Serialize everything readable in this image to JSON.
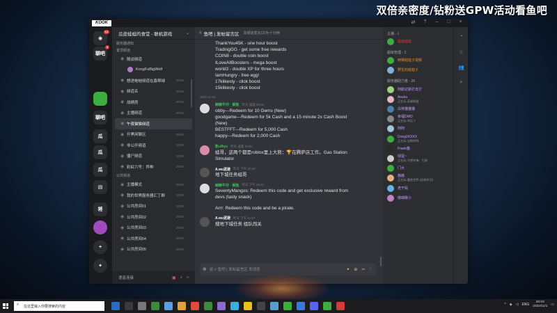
{
  "overlay": {
    "banner": "双倍亲密度/钻粉送GPW活动看鱼吧"
  },
  "window": {
    "logo": "KOOK",
    "controls": [
      "⇄",
      "?",
      "–",
      "□",
      "×"
    ]
  },
  "rail": {
    "servers": [
      {
        "label": "◉",
        "badge": "12",
        "color": "#2b2d31"
      },
      {
        "label": "聊吧",
        "badge": "4",
        "color": "#2b2d31"
      },
      {
        "label": "",
        "badge": "",
        "color": "#3cae3f"
      },
      {
        "label": "聊吧",
        "badge": "",
        "color": "#2b2d31"
      },
      {
        "label": "瓜",
        "badge": "",
        "color": "#2b2d31"
      },
      {
        "label": "瓜",
        "badge": "",
        "color": "#2b2d31"
      },
      {
        "label": "瓜",
        "badge": "",
        "color": "#2b2d31"
      },
      {
        "label": "▤",
        "badge": "",
        "color": "#2b2d31"
      },
      {
        "label": "将",
        "badge": "",
        "color": "#2b2d31"
      },
      {
        "label": "",
        "badge": "",
        "color": "#a04bc0"
      },
      {
        "label": "+",
        "badge": "",
        "color": "#2b2d31"
      },
      {
        "label": "✦",
        "badge": "",
        "color": "#2b2d31"
      }
    ]
  },
  "channels": {
    "server_name": "瓜皮蛙蛙的食堂 - 联机游戏",
    "categories": [
      {
        "name": "服务器通知",
        "items": []
      },
      {
        "name": "置顶频道",
        "items": [
          {
            "name": "随谈频道",
            "count": ""
          },
          {
            "name": "KongFuBigWolf",
            "count": "",
            "user": true
          },
          {
            "name": "想进蛙蛙频道在鑫帮绿",
            "count": "20/50"
          },
          {
            "name": "频道名",
            "count": "20/50"
          },
          {
            "name": "战绩房",
            "count": "20/50"
          },
          {
            "name": "主播频道",
            "count": "20/50"
          },
          {
            "name": "午夜猫猫频道",
            "count": "",
            "active": true
          },
          {
            "name": "开黑闲聊区",
            "count": "20/50"
          },
          {
            "name": "非公开频道",
            "count": "20/50"
          },
          {
            "name": "僵尸频道",
            "count": "20/50"
          },
          {
            "name": "彩虹六号：异种",
            "count": "20/50"
          }
        ]
      },
      {
        "name": "公共频道",
        "items": [
          {
            "name": "主播模式",
            "count": "20/50"
          },
          {
            "name": "我的世界服务器汇丁群",
            "count": "20/50"
          },
          {
            "name": "公共房间01",
            "count": "20/50"
          },
          {
            "name": "公共房间02",
            "count": "20/50"
          },
          {
            "name": "公共房间03",
            "count": "20/50"
          },
          {
            "name": "公共房间04",
            "count": "20/50"
          },
          {
            "name": "公共房间05",
            "count": "20/50"
          }
        ]
      }
    ],
    "footer": "语音连接"
  },
  "chat": {
    "channel": "鱼吧 | 发帖留言区",
    "topic": "本频道发言CD为十分钟",
    "pre_lines": [
      "ThankYou45K - one hour boost",
      "TradingGG - get some free rewards",
      "COIN8 - double coin boost",
      "ILoveAllBoosters - mega boost",
      "world3 - double XP for three hours",
      "IamHungry - free egg!",
      "17klikesty - click boost",
      "15klikesty - click boost"
    ],
    "time_sep": "2022-11-01",
    "messages": [
      {
        "author": "鲸鲸牛仔 · 钢鱼",
        "author_color": "#3fbf5a",
        "time": "昨天 凌晨 00:04",
        "avatar": "#dcdcdc",
        "lines": [
          "obby---Redeem for 10 Gems (New)",
          "goodgame---Redeem for 5k Cash and a 15 minute 2x Cash Boost",
          "(New)",
          "BESTFFT---Redeem for 5,000 Cash",
          "happy---Redeem for 2,000 Cash"
        ]
      },
      {
        "author": "影ufkys",
        "author_color": "#3fbf5a",
        "time": "昨天 凌晨 00:04",
        "avatar": "#d98ca8",
        "lines": [
          "蛙哥，这两个都是roblox里上大熊：🏆在腾萨店工作。Gas Station",
          "Simulator"
        ]
      },
      {
        "author": "A.wu泥逊",
        "author_color": "#ffffff",
        "time": "昨天 下午 10:40",
        "avatar": "#555555",
        "lines": [
          "地下城任务蛙哥"
        ]
      },
      {
        "author": "鲸鲸牛仔 · 钢鱼",
        "author_color": "#3fbf5a",
        "time": "昨天 下午 10:41",
        "avatar": "#dcdcdc",
        "lines": [
          "SeventyMangos: Redeem this code and get exclusive reward from",
          "devs (tasty snack)",
          "",
          "Arrr: Redeem this code and be a pirate."
        ]
      },
      {
        "author": "A.wu泥逊",
        "author_color": "#ffffff",
        "time": "昨天 下午 11:57",
        "avatar": "#555555",
        "lines": [
          "搜地下城任务 组队闯关"
        ]
      }
    ],
    "input_placeholder": "给 # 鱼吧 | 发帖留言区 发消息"
  },
  "members": {
    "groups": [
      {
        "title": "主播 - 1",
        "items": [
          {
            "name": "蛙蛙蛙蛙",
            "status": "",
            "color": "#e53935",
            "av": "#3cae3f"
          }
        ]
      },
      {
        "title": "超级管理 - 2",
        "items": [
          {
            "name": "两栖蛙蛙子视频",
            "status": "",
            "color": "#e58b2a",
            "av": "#3cae3f"
          },
          {
            "name": "野生的蛙蛙子",
            "status": "",
            "color": "#e58b2a",
            "av": "#7fb0d8"
          }
        ]
      },
      {
        "title": "服务器助力者 - 29",
        "items": [
          {
            "name": "阿斯达斯打去打",
            "status": "",
            "color": "#c89cff",
            "av": "#9bd27b"
          },
          {
            "name": "Asuka",
            "status": "正在玩 英雄联盟",
            "color": "#c89cff",
            "av": "#e6b5c8"
          },
          {
            "name": "白林猫猫猫",
            "status": "",
            "color": "#c89cff",
            "av": "#4d7ea8"
          },
          {
            "name": "幸福DMO",
            "status": "正在玩 命运 2",
            "color": "#c89cff",
            "av": "#888888"
          },
          {
            "name": "阿阿",
            "status": "",
            "color": "#c89cff",
            "av": "#a0c4d8"
          },
          {
            "name": "Dong0XXXX",
            "status": "正在玩 宝狮特殊",
            "color": "#c89cff",
            "av": "#3cae3f"
          },
          {
            "name": "Frank猫",
            "status": "",
            "color": "#c89cff",
            "av": "#2a2a2a"
          },
          {
            "name": "绿蛋~",
            "status": "正在玩 守望先锋：归来",
            "color": "#c89cff",
            "av": "#cccccc"
          },
          {
            "name": "门大",
            "status": "",
            "color": "#c89cff",
            "av": "#3cae3f"
          },
          {
            "name": "茜茜",
            "status": "正在玩 魔兽世界 (经典怀旧)",
            "color": "#c89cff",
            "av": "#e0b080"
          },
          {
            "name": "老干妈",
            "status": "",
            "color": "#c89cff",
            "av": "#6ab0e0"
          },
          {
            "name": "珊瑚礁小",
            "status": "",
            "color": "#c89cff",
            "av": "#c080c0"
          }
        ]
      }
    ],
    "side_icons": [
      "bell-icon",
      "pin-icon",
      "members-icon",
      "search-icon"
    ]
  },
  "taskbar": {
    "search_placeholder": "在这里输入你要搜索的内容",
    "tray_lang": "ENG",
    "time": "20:03",
    "date": "2022/11/1",
    "app_colors": [
      "#2d6ac4",
      "#3a3a3a",
      "#777777",
      "#3c8a3c",
      "#5aa0e0",
      "#e0a040",
      "#e04a3a",
      "#3c8a3c",
      "#8c6ad0",
      "#3ab0e0",
      "#e8c020",
      "#444444",
      "#5a9ed0",
      "#3cae3f",
      "#3a78d8",
      "#5865f2",
      "#3cae3f",
      "#d43c3c"
    ]
  }
}
